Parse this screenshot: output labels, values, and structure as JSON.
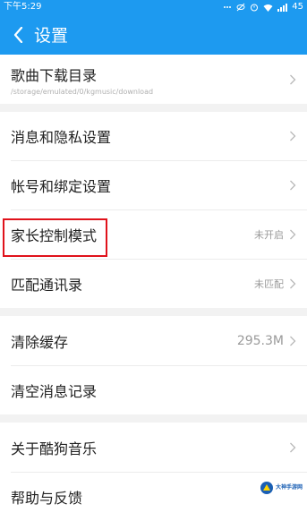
{
  "status_bar": {
    "time": "下午5:29",
    "battery": "45"
  },
  "header": {
    "title": "设置"
  },
  "settings": {
    "download_dir": {
      "label": "歌曲下载目录",
      "path": "/storage/emulated/0/kgmusic/download"
    },
    "privacy": {
      "label": "消息和隐私设置"
    },
    "account": {
      "label": "帐号和绑定设置"
    },
    "parental": {
      "label": "家长控制模式",
      "value": "未开启"
    },
    "contacts": {
      "label": "匹配通讯录",
      "value": "未匹配"
    },
    "cache": {
      "label": "清除缓存",
      "value": "295.3M"
    },
    "clear_messages": {
      "label": "清空消息记录"
    },
    "about": {
      "label": "关于酷狗音乐"
    },
    "help": {
      "label": "帮助与反馈"
    }
  },
  "watermark": {
    "text": "大神手游网"
  },
  "colors": {
    "header_bg": "#1d9af0",
    "highlight": "#e0121b"
  }
}
